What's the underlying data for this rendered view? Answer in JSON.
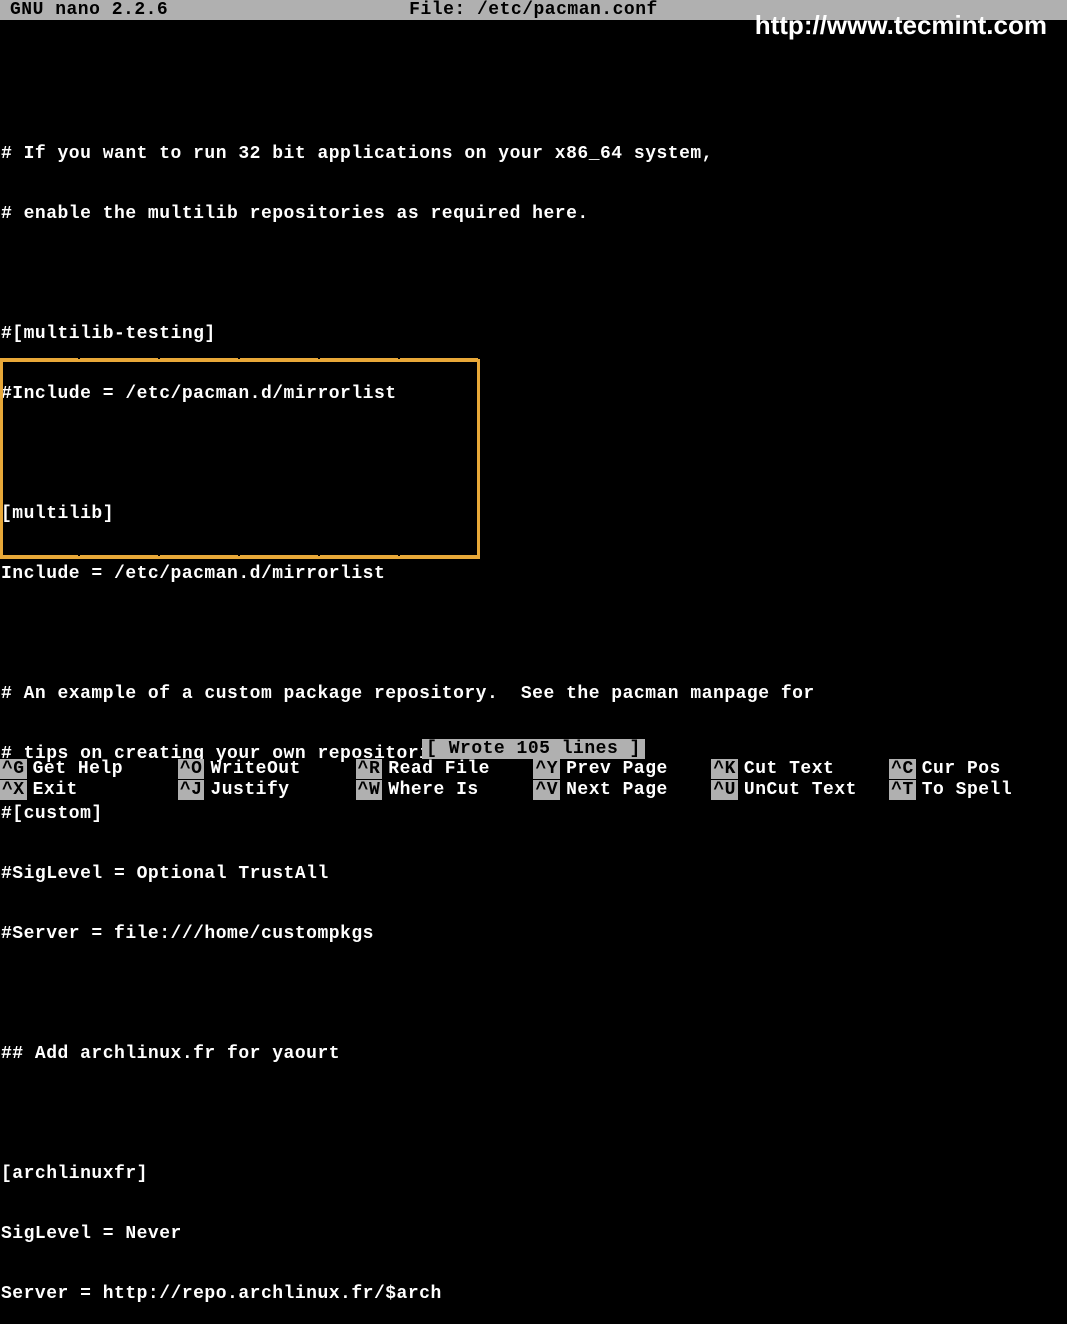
{
  "titlebar": {
    "app": "GNU nano 2.2.6",
    "file_label": "File: /etc/pacman.conf"
  },
  "watermark": "http://www.tecmint.com",
  "content": {
    "lines": [
      "",
      "# If you want to run 32 bit applications on your x86_64 system,",
      "# enable the multilib repositories as required here.",
      "",
      "#[multilib-testing]",
      "#Include = /etc/pacman.d/mirrorlist",
      "",
      "[multilib]",
      "Include = /etc/pacman.d/mirrorlist",
      "",
      "# An example of a custom package repository.  See the pacman manpage for",
      "# tips on creating your own repositories.",
      "#[custom]",
      "#SigLevel = Optional TrustAll",
      "#Server = file:///home/custompkgs",
      "",
      "## Add archlinux.fr for yaourt",
      "",
      "[archlinuxfr]",
      "SigLevel = Never",
      "Server = http://repo.archlinux.fr/$arch"
    ]
  },
  "status": "[ Wrote 105 lines ]",
  "shortcuts": {
    "row1": [
      {
        "key": "^G",
        "label": "Get Help"
      },
      {
        "key": "^O",
        "label": "WriteOut"
      },
      {
        "key": "^R",
        "label": "Read File"
      },
      {
        "key": "^Y",
        "label": "Prev Page"
      },
      {
        "key": "^K",
        "label": "Cut Text"
      },
      {
        "key": "^C",
        "label": "Cur Pos"
      }
    ],
    "row2": [
      {
        "key": "^X",
        "label": "Exit"
      },
      {
        "key": "^J",
        "label": "Justify"
      },
      {
        "key": "^W",
        "label": "Where Is"
      },
      {
        "key": "^V",
        "label": "Next Page"
      },
      {
        "key": "^U",
        "label": "UnCut Text"
      },
      {
        "key": "^T",
        "label": "To Spell"
      }
    ]
  }
}
